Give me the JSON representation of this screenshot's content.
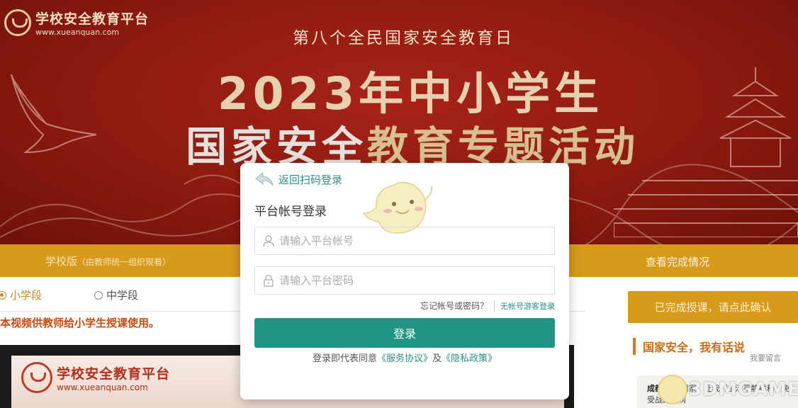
{
  "banner": {
    "logo_name": "学校安全教育平台",
    "logo_url": "www.xueanquan.com",
    "day_title": "第八个全民国家安全教育日",
    "main_title": "2023年中小学生",
    "sub_title_a": "国家安全",
    "sub_title_b": "教育专题活动"
  },
  "nav": {
    "school_label": "学校版",
    "school_note": "（由教师统一组织观看）",
    "view_completion": "查看完成情况"
  },
  "content": {
    "grade_primary": "小学段",
    "grade_middle": "中学段",
    "notice": "本视频供教师给小学生授课使用。",
    "video_logo_name": "学校安全教育平台",
    "video_logo_url": "www.xueanquan.com"
  },
  "sidebar": {
    "confirm_button": "已完成授课，请点此确认",
    "heading": "国家安全，我有话说",
    "leave_message": "我要留言",
    "message_author": "成都",
    "message_text": "感谢国家，让我们生活平静祥和，免受战乱疾病"
  },
  "modal": {
    "back_link": "返回扫码登录",
    "title": "平台帐号登录",
    "account_placeholder": "请输入平台帐号",
    "password_placeholder": "请输入平台密码",
    "forgot": "忘记帐号或密码？",
    "guest_login": "无帐号游客登录",
    "login_button": "登录",
    "agree_prefix": "登录即代表同意",
    "service_agreement": "《服务协议》",
    "agree_and": "及",
    "privacy_policy": "《隐私政策》"
  },
  "watermark": "3DMGAME",
  "colors": {
    "banner_red": "#8d1a10",
    "nav_gold": "#d79a1c",
    "accent_teal": "#219583",
    "notice_orange": "#c84a0e"
  }
}
